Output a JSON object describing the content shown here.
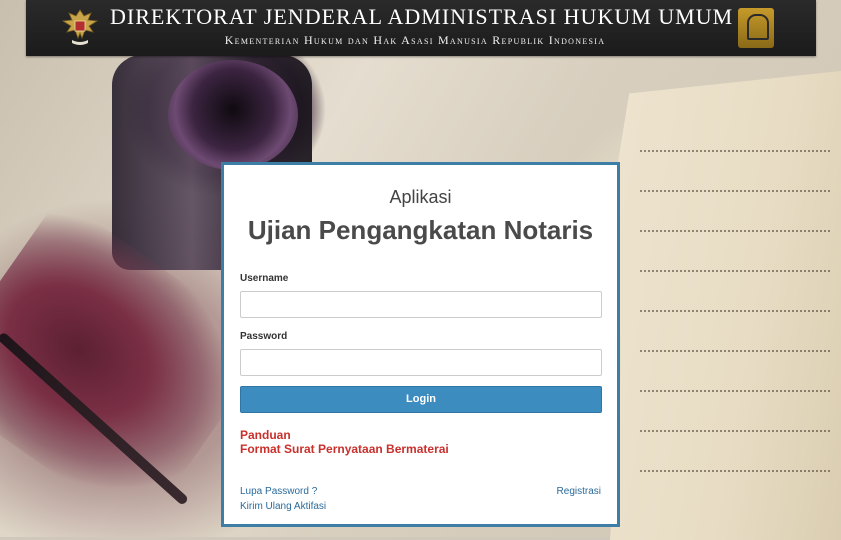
{
  "header": {
    "title": "DIREKTORAT JENDERAL ADMINISTRASI HUKUM UMUM",
    "subtitle": "Kementerian Hukum dan Hak Asasi Manusia Republik Indonesia",
    "emblem_icon": "garuda-emblem-icon",
    "right_logo_icon": "ministry-logo-icon"
  },
  "login": {
    "app_label": "Aplikasi",
    "app_title": "Ujian Pengangkatan Notaris",
    "username_label": "Username",
    "username_value": "",
    "password_label": "Password",
    "password_value": "",
    "login_button": "Login",
    "links": {
      "guide": "Panduan",
      "statement_format": "Format Surat Pernyataan Bermaterai",
      "forgot_password": "Lupa Password ?",
      "register": "Registrasi",
      "resend_activation": "Kirim Ulang Aktifasi"
    }
  },
  "colors": {
    "accent": "#3c8cc0",
    "card_border": "#3c7ea6",
    "link_red": "#c9302c",
    "header_bg": "#1b1b1b"
  }
}
